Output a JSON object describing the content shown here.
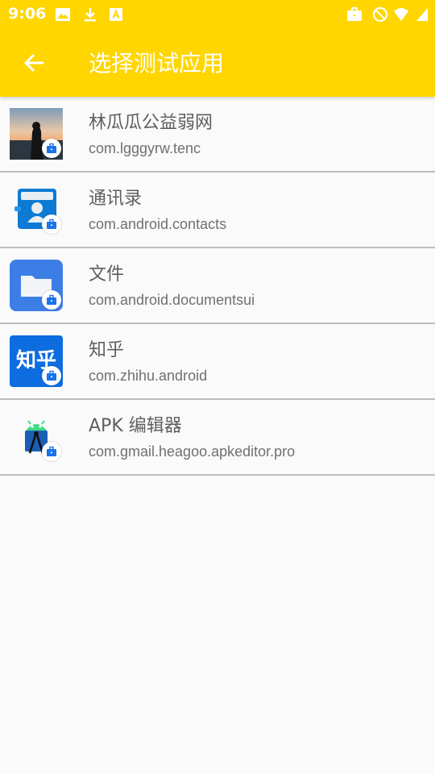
{
  "status_bar": {
    "time": "9:06"
  },
  "app_bar": {
    "title": "选择测试应用",
    "background": "#ffd600"
  },
  "apps": [
    {
      "name": "林瓜瓜公益弱网",
      "package": "com.lgggyrw.tenc",
      "icon": "photo-icon"
    },
    {
      "name": "通讯录",
      "package": "com.android.contacts",
      "icon": "contacts-icon"
    },
    {
      "name": "文件",
      "package": "com.android.documentsui",
      "icon": "folder-icon"
    },
    {
      "name": "知乎",
      "package": "com.zhihu.android",
      "icon": "zhihu-icon",
      "icon_text": "知乎"
    },
    {
      "name": "APK 编辑器",
      "package": "com.gmail.heagoo.apkeditor.pro",
      "icon": "apk-editor-icon"
    }
  ],
  "colors": {
    "accent": "#ffd600",
    "badge": "#1a73e8",
    "divider": "#bdbdbd"
  }
}
